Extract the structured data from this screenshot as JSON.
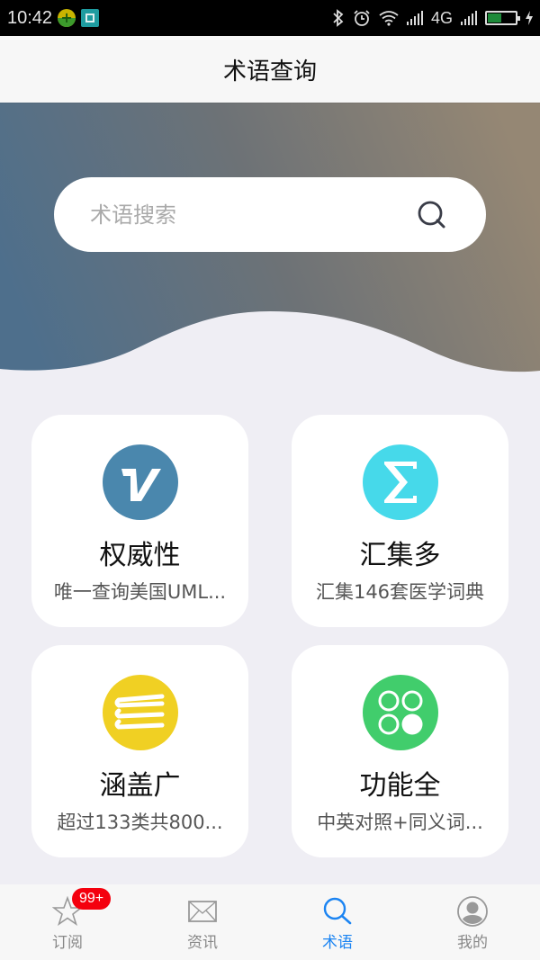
{
  "status_bar": {
    "time": "10:42",
    "network": "4G",
    "notification_icons": [
      "app-notification-icon",
      "screenshot-icon"
    ],
    "indicator_icons": [
      "bluetooth-icon",
      "alarm-icon",
      "wifi-icon",
      "signal-icon",
      "signal-icon",
      "battery-charging-icon"
    ],
    "battery_level": 0.5
  },
  "header": {
    "title": "术语查询"
  },
  "search": {
    "placeholder": "术语搜索",
    "value": "",
    "icon": "search-icon"
  },
  "features": [
    {
      "title": "权威性",
      "desc": "唯一查询美国UML...",
      "icon": "v-logo-icon",
      "color": "#4a87ad"
    },
    {
      "title": "汇集多",
      "desc": "汇集146套医学词典",
      "icon": "sigma-icon",
      "color": "#46d9ea"
    },
    {
      "title": "涵盖广",
      "desc": "超过133类共800...",
      "icon": "books-stack-icon",
      "color": "#f0d023"
    },
    {
      "title": "功能全",
      "desc": "中英对照+同义词...",
      "icon": "four-circles-icon",
      "color": "#41cd6c"
    }
  ],
  "tab_bar": {
    "tabs": [
      {
        "label": "订阅",
        "icon": "star-icon",
        "badge": "99+",
        "active": false
      },
      {
        "label": "资讯",
        "icon": "envelope-icon",
        "active": false
      },
      {
        "label": "术语",
        "icon": "search-icon",
        "active": true
      },
      {
        "label": "我的",
        "icon": "user-avatar-icon",
        "active": false
      }
    ],
    "active_color": "#1b84f2",
    "badge_color": "#f4000e"
  }
}
